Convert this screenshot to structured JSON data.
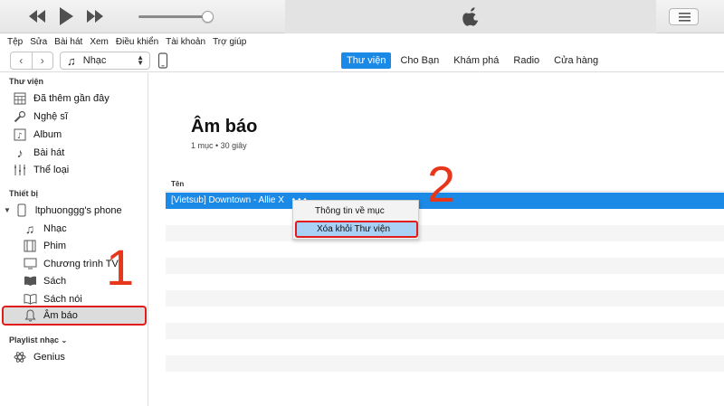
{
  "menubar": [
    "Tệp",
    "Sửa",
    "Bài hát",
    "Xem",
    "Điều khiển",
    "Tài khoản",
    "Trợ giúp"
  ],
  "toolbar": {
    "source_label": "Nhạc",
    "tabs": [
      "Thư viện",
      "Cho Bạn",
      "Khám phá",
      "Radio",
      "Cửa hàng"
    ],
    "active_tab": "Thư viện"
  },
  "sidebar": {
    "library_header": "Thư viện",
    "library_items": [
      "Đã thêm gần đây",
      "Nghệ sĩ",
      "Album",
      "Bài hát",
      "Thể loại"
    ],
    "devices_header": "Thiết bị",
    "device_name": "ltphuonggg's phone",
    "device_items": [
      "Nhạc",
      "Phim",
      "Chương trình TV",
      "Sách",
      "Sách nói",
      "Âm báo"
    ],
    "playlists_header": "Playlist nhạc",
    "playlist_items": [
      "Genius"
    ]
  },
  "main": {
    "title": "Âm báo",
    "subtitle": "1 mục • 30 giây",
    "column_header": "Tên",
    "selected_row": "[Vietsub] Downtown - Allie X",
    "selected_row_more": "• • •"
  },
  "context_menu": {
    "items": [
      "Thông tin về mục",
      "Xóa khỏi Thư viện"
    ]
  },
  "annotations": {
    "step1": "1",
    "step2": "2"
  },
  "colors": {
    "accent": "#1a8ae6",
    "annotation": "#e8361b",
    "highlight_border": "#e11b1b"
  }
}
